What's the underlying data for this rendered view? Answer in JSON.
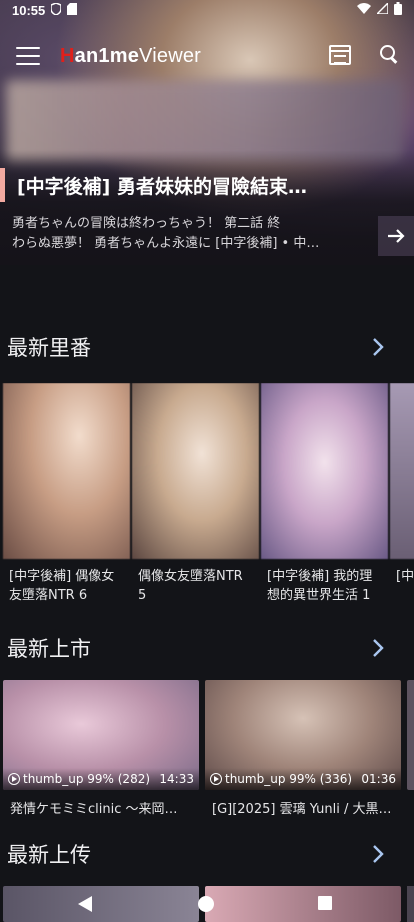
{
  "status_bar": {
    "time": "10:55",
    "icons": [
      "shield-icon",
      "sd-card-icon",
      "wifi-icon",
      "signal-icon",
      "battery-icon"
    ]
  },
  "app_bar": {
    "logo_h": "H",
    "logo_an": "an",
    "logo_1me": "1me",
    "logo_viewer": "Viewer",
    "menu_icon": "menu-icon",
    "calendar_icon": "calendar-icon",
    "search_icon": "search-icon"
  },
  "hero": {
    "title": "[中字後補] 勇者妹妹的冒險結束…",
    "desc_line1": "勇者ちゃんの冒険は終わっちゃう！ 第二話 終",
    "desc_line2": "わらぬ悪夢！ 勇者ちゃんよ永遠に [中字後補] • 中…",
    "arrow_icon": "arrow-right-icon"
  },
  "sections": {
    "latest_hentai": {
      "title": "最新里番",
      "items": [
        {
          "caption": "[中字後補] 偶像女友墮落NTR 6"
        },
        {
          "caption": "偶像女友墮落NTR 5"
        },
        {
          "caption": "[中字後補] 我的理想的異世界生活 1"
        },
        {
          "caption": "[中字後補] 落X…"
        }
      ]
    },
    "latest_release": {
      "title": "最新上市",
      "items": [
        {
          "likes": "thumb_up 99% (282)",
          "duration": "14:33",
          "caption": "発情ケモミミclinic 〜来岡…"
        },
        {
          "likes": "thumb_up 99% (336)",
          "duration": "01:36",
          "caption": "[G][2025] 雲璃 Yunli / 大黒…"
        }
      ]
    },
    "latest_upload": {
      "title": "最新上传"
    }
  },
  "nav_bar": {
    "back_icon": "back-icon",
    "home_icon": "home-icon",
    "recents_icon": "recents-icon"
  }
}
